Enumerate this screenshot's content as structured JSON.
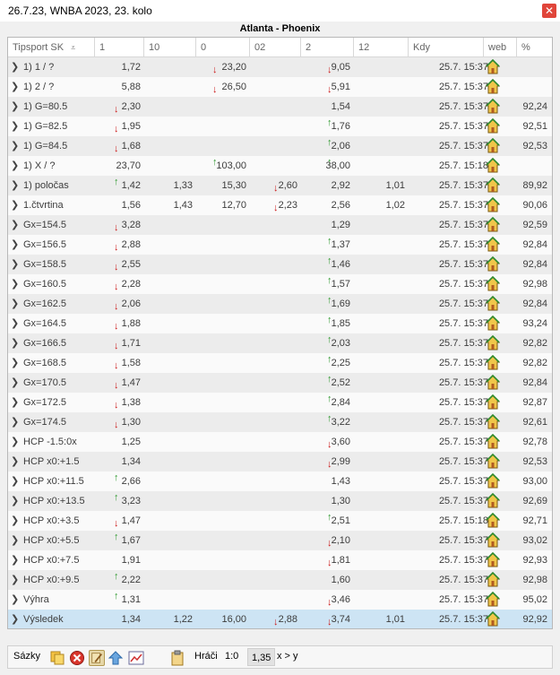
{
  "window": {
    "title": "26.7.23, WNBA 2023, 23. kolo",
    "close_symbol": "✕"
  },
  "match_title": "Atlanta - Phoenix",
  "columns": [
    "Tipsport SK",
    "1",
    "10",
    "0",
    "02",
    "2",
    "12",
    "Kdy",
    "web",
    "%"
  ],
  "rows": [
    {
      "name": "1) 1 / ?",
      "c1": {
        "v": "1,72"
      },
      "c10": {
        "v": ""
      },
      "c0": {
        "v": "23,20",
        "a": "down"
      },
      "c02": {
        "v": ""
      },
      "c2": {
        "v": "9,05",
        "a": "down"
      },
      "c12": {
        "v": ""
      },
      "kdy": "25.7. 15:37",
      "pct": ""
    },
    {
      "name": "1) 2 / ?",
      "c1": {
        "v": "5,88"
      },
      "c10": {
        "v": ""
      },
      "c0": {
        "v": "26,50",
        "a": "down"
      },
      "c02": {
        "v": ""
      },
      "c2": {
        "v": "5,91",
        "a": "down"
      },
      "c12": {
        "v": ""
      },
      "kdy": "25.7. 15:37",
      "pct": ""
    },
    {
      "name": "1) G=80.5",
      "c1": {
        "v": "2,30",
        "a": "down"
      },
      "c10": {
        "v": ""
      },
      "c0": {
        "v": ""
      },
      "c02": {
        "v": ""
      },
      "c2": {
        "v": "1,54"
      },
      "c12": {
        "v": ""
      },
      "kdy": "25.7. 15:37",
      "pct": "92,24"
    },
    {
      "name": "1) G=82.5",
      "c1": {
        "v": "1,95",
        "a": "down"
      },
      "c10": {
        "v": ""
      },
      "c0": {
        "v": ""
      },
      "c02": {
        "v": ""
      },
      "c2": {
        "v": "1,76",
        "a": "up"
      },
      "c12": {
        "v": ""
      },
      "kdy": "25.7. 15:37",
      "pct": "92,51"
    },
    {
      "name": "1) G=84.5",
      "c1": {
        "v": "1,68",
        "a": "down"
      },
      "c10": {
        "v": ""
      },
      "c0": {
        "v": ""
      },
      "c02": {
        "v": ""
      },
      "c2": {
        "v": "2,06",
        "a": "up"
      },
      "c12": {
        "v": ""
      },
      "kdy": "25.7. 15:37",
      "pct": "92,53"
    },
    {
      "name": "1) X / ?",
      "c1": {
        "v": "23,70"
      },
      "c10": {
        "v": ""
      },
      "c0": {
        "v": "103,00",
        "a": "up"
      },
      "c02": {
        "v": ""
      },
      "c2": {
        "v": "38,00",
        "a": "up"
      },
      "c12": {
        "v": ""
      },
      "kdy": "25.7. 15:18",
      "pct": ""
    },
    {
      "name": "1) poločas",
      "c1": {
        "v": "1,42",
        "a": "up"
      },
      "c10": {
        "v": "1,33"
      },
      "c0": {
        "v": "15,30"
      },
      "c02": {
        "v": "2,60",
        "a": "down"
      },
      "c2": {
        "v": "2,92"
      },
      "c12": {
        "v": "1,01"
      },
      "kdy": "25.7. 15:37",
      "pct": "89,92"
    },
    {
      "name": "1.čtvrtina",
      "c1": {
        "v": "1,56"
      },
      "c10": {
        "v": "1,43"
      },
      "c0": {
        "v": "12,70"
      },
      "c02": {
        "v": "2,23",
        "a": "down"
      },
      "c2": {
        "v": "2,56"
      },
      "c12": {
        "v": "1,02"
      },
      "kdy": "25.7. 15:37",
      "pct": "90,06"
    },
    {
      "name": "Gx=154.5",
      "c1": {
        "v": "3,28",
        "a": "down"
      },
      "c10": {
        "v": ""
      },
      "c0": {
        "v": ""
      },
      "c02": {
        "v": ""
      },
      "c2": {
        "v": "1,29"
      },
      "c12": {
        "v": ""
      },
      "kdy": "25.7. 15:37",
      "pct": "92,59"
    },
    {
      "name": "Gx=156.5",
      "c1": {
        "v": "2,88",
        "a": "down"
      },
      "c10": {
        "v": ""
      },
      "c0": {
        "v": ""
      },
      "c02": {
        "v": ""
      },
      "c2": {
        "v": "1,37",
        "a": "up"
      },
      "c12": {
        "v": ""
      },
      "kdy": "25.7. 15:37",
      "pct": "92,84"
    },
    {
      "name": "Gx=158.5",
      "c1": {
        "v": "2,55",
        "a": "down"
      },
      "c10": {
        "v": ""
      },
      "c0": {
        "v": ""
      },
      "c02": {
        "v": ""
      },
      "c2": {
        "v": "1,46",
        "a": "up"
      },
      "c12": {
        "v": ""
      },
      "kdy": "25.7. 15:37",
      "pct": "92,84"
    },
    {
      "name": "Gx=160.5",
      "c1": {
        "v": "2,28",
        "a": "down"
      },
      "c10": {
        "v": ""
      },
      "c0": {
        "v": ""
      },
      "c02": {
        "v": ""
      },
      "c2": {
        "v": "1,57",
        "a": "up"
      },
      "c12": {
        "v": ""
      },
      "kdy": "25.7. 15:37",
      "pct": "92,98"
    },
    {
      "name": "Gx=162.5",
      "c1": {
        "v": "2,06",
        "a": "down"
      },
      "c10": {
        "v": ""
      },
      "c0": {
        "v": ""
      },
      "c02": {
        "v": ""
      },
      "c2": {
        "v": "1,69",
        "a": "up"
      },
      "c12": {
        "v": ""
      },
      "kdy": "25.7. 15:37",
      "pct": "92,84"
    },
    {
      "name": "Gx=164.5",
      "c1": {
        "v": "1,88",
        "a": "down"
      },
      "c10": {
        "v": ""
      },
      "c0": {
        "v": ""
      },
      "c02": {
        "v": ""
      },
      "c2": {
        "v": "1,85",
        "a": "up"
      },
      "c12": {
        "v": ""
      },
      "kdy": "25.7. 15:37",
      "pct": "93,24"
    },
    {
      "name": "Gx=166.5",
      "c1": {
        "v": "1,71",
        "a": "down"
      },
      "c10": {
        "v": ""
      },
      "c0": {
        "v": ""
      },
      "c02": {
        "v": ""
      },
      "c2": {
        "v": "2,03",
        "a": "up"
      },
      "c12": {
        "v": ""
      },
      "kdy": "25.7. 15:37",
      "pct": "92,82"
    },
    {
      "name": "Gx=168.5",
      "c1": {
        "v": "1,58",
        "a": "down"
      },
      "c10": {
        "v": ""
      },
      "c0": {
        "v": ""
      },
      "c02": {
        "v": ""
      },
      "c2": {
        "v": "2,25",
        "a": "up"
      },
      "c12": {
        "v": ""
      },
      "kdy": "25.7. 15:37",
      "pct": "92,82"
    },
    {
      "name": "Gx=170.5",
      "c1": {
        "v": "1,47",
        "a": "down"
      },
      "c10": {
        "v": ""
      },
      "c0": {
        "v": ""
      },
      "c02": {
        "v": ""
      },
      "c2": {
        "v": "2,52",
        "a": "up"
      },
      "c12": {
        "v": ""
      },
      "kdy": "25.7. 15:37",
      "pct": "92,84"
    },
    {
      "name": "Gx=172.5",
      "c1": {
        "v": "1,38",
        "a": "down"
      },
      "c10": {
        "v": ""
      },
      "c0": {
        "v": ""
      },
      "c02": {
        "v": ""
      },
      "c2": {
        "v": "2,84",
        "a": "up"
      },
      "c12": {
        "v": ""
      },
      "kdy": "25.7. 15:37",
      "pct": "92,87"
    },
    {
      "name": "Gx=174.5",
      "c1": {
        "v": "1,30",
        "a": "down"
      },
      "c10": {
        "v": ""
      },
      "c0": {
        "v": ""
      },
      "c02": {
        "v": ""
      },
      "c2": {
        "v": "3,22",
        "a": "up"
      },
      "c12": {
        "v": ""
      },
      "kdy": "25.7. 15:37",
      "pct": "92,61"
    },
    {
      "name": "HCP -1.5:0x",
      "c1": {
        "v": "1,25"
      },
      "c10": {
        "v": ""
      },
      "c0": {
        "v": ""
      },
      "c02": {
        "v": ""
      },
      "c2": {
        "v": "3,60",
        "a": "down"
      },
      "c12": {
        "v": ""
      },
      "kdy": "25.7. 15:37",
      "pct": "92,78"
    },
    {
      "name": "HCP x0:+1.5",
      "c1": {
        "v": "1,34"
      },
      "c10": {
        "v": ""
      },
      "c0": {
        "v": ""
      },
      "c02": {
        "v": ""
      },
      "c2": {
        "v": "2,99",
        "a": "down"
      },
      "c12": {
        "v": ""
      },
      "kdy": "25.7. 15:37",
      "pct": "92,53"
    },
    {
      "name": "HCP x0:+11.5",
      "c1": {
        "v": "2,66",
        "a": "up"
      },
      "c10": {
        "v": ""
      },
      "c0": {
        "v": ""
      },
      "c02": {
        "v": ""
      },
      "c2": {
        "v": "1,43"
      },
      "c12": {
        "v": ""
      },
      "kdy": "25.7. 15:37",
      "pct": "93,00"
    },
    {
      "name": "HCP x0:+13.5",
      "c1": {
        "v": "3,23",
        "a": "up"
      },
      "c10": {
        "v": ""
      },
      "c0": {
        "v": ""
      },
      "c02": {
        "v": ""
      },
      "c2": {
        "v": "1,30"
      },
      "c12": {
        "v": ""
      },
      "kdy": "25.7. 15:37",
      "pct": "92,69"
    },
    {
      "name": "HCP x0:+3.5",
      "c1": {
        "v": "1,47",
        "a": "down"
      },
      "c10": {
        "v": ""
      },
      "c0": {
        "v": ""
      },
      "c02": {
        "v": ""
      },
      "c2": {
        "v": "2,51",
        "a": "up"
      },
      "c12": {
        "v": ""
      },
      "kdy": "25.7. 15:18",
      "pct": "92,71"
    },
    {
      "name": "HCP x0:+5.5",
      "c1": {
        "v": "1,67",
        "a": "up"
      },
      "c10": {
        "v": ""
      },
      "c0": {
        "v": ""
      },
      "c02": {
        "v": ""
      },
      "c2": {
        "v": "2,10",
        "a": "down"
      },
      "c12": {
        "v": ""
      },
      "kdy": "25.7. 15:37",
      "pct": "93,02"
    },
    {
      "name": "HCP x0:+7.5",
      "c1": {
        "v": "1,91"
      },
      "c10": {
        "v": ""
      },
      "c0": {
        "v": ""
      },
      "c02": {
        "v": ""
      },
      "c2": {
        "v": "1,81",
        "a": "down"
      },
      "c12": {
        "v": ""
      },
      "kdy": "25.7. 15:37",
      "pct": "92,93"
    },
    {
      "name": "HCP x0:+9.5",
      "c1": {
        "v": "2,22",
        "a": "up"
      },
      "c10": {
        "v": ""
      },
      "c0": {
        "v": ""
      },
      "c02": {
        "v": ""
      },
      "c2": {
        "v": "1,60"
      },
      "c12": {
        "v": ""
      },
      "kdy": "25.7. 15:37",
      "pct": "92,98"
    },
    {
      "name": "Výhra",
      "c1": {
        "v": "1,31",
        "a": "up"
      },
      "c10": {
        "v": ""
      },
      "c0": {
        "v": ""
      },
      "c02": {
        "v": ""
      },
      "c2": {
        "v": "3,46",
        "a": "down"
      },
      "c12": {
        "v": ""
      },
      "kdy": "25.7. 15:37",
      "pct": "95,02"
    },
    {
      "name": "Výsledek",
      "c1": {
        "v": "1,34"
      },
      "c10": {
        "v": "1,22"
      },
      "c0": {
        "v": "16,00"
      },
      "c02": {
        "v": "2,88",
        "a": "down"
      },
      "c2": {
        "v": "3,74",
        "a": "down"
      },
      "c12": {
        "v": "1,01"
      },
      "kdy": "25.7. 15:37",
      "pct": "92,92",
      "selected": true
    }
  ],
  "toolbar": {
    "sazky_label": "Sázky",
    "hraci_label": "Hráči",
    "score": "1:0",
    "odds": "1,35",
    "relation": "x > y"
  },
  "colors": {
    "up_arrow": "#2e9a2e",
    "down_arrow": "#cc1a1a",
    "selected_row": "#cde4f4",
    "close_button": "#e0453a"
  }
}
